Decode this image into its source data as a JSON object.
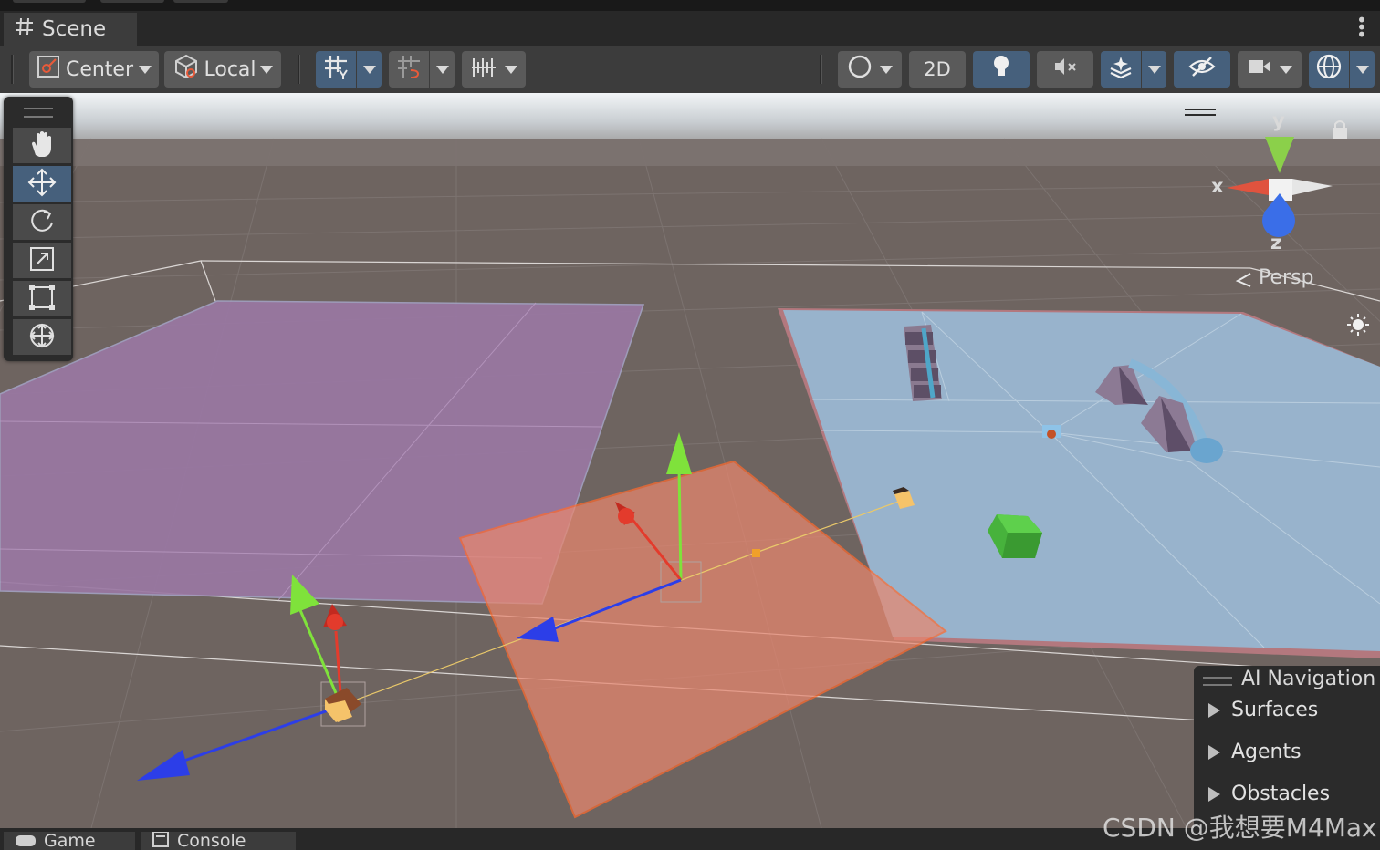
{
  "colors": {
    "background": "#191919",
    "panel": "#3c3c3c",
    "button": "#5a5a5a",
    "active": "#46607c",
    "ground": "#6e6460",
    "pink_plane": "#9a78a3",
    "orange_plane": "#e8876f",
    "blue_navmesh": "#98b3cc",
    "axis_x": "#e33b2c",
    "axis_y": "#7fe23b",
    "axis_z": "#2c3ee8"
  },
  "tab": {
    "label": "Scene",
    "icon": "hash-icon"
  },
  "toolbar": {
    "pivot_label": "Center",
    "space_label": "Local",
    "mode_2d_label": "2D"
  },
  "tools": [
    {
      "name": "view-tool",
      "icon": "hand-icon"
    },
    {
      "name": "move-tool",
      "icon": "move-arrows-icon"
    },
    {
      "name": "rotate-tool",
      "icon": "rotate-icon"
    },
    {
      "name": "scale-tool",
      "icon": "scale-icon"
    },
    {
      "name": "rect-tool",
      "icon": "rect-transform-icon"
    },
    {
      "name": "transform-tool",
      "icon": "transform-icon"
    }
  ],
  "gizmo": {
    "x_label": "x",
    "y_label": "y",
    "z_label": "z",
    "projection_label": "Persp"
  },
  "ai_navigation": {
    "title": "AI Navigation",
    "items": [
      "Surfaces",
      "Agents",
      "Obstacles"
    ]
  },
  "bottom_tabs": [
    "Game",
    "Console"
  ],
  "watermark": "CSDN @我想要M4Max"
}
